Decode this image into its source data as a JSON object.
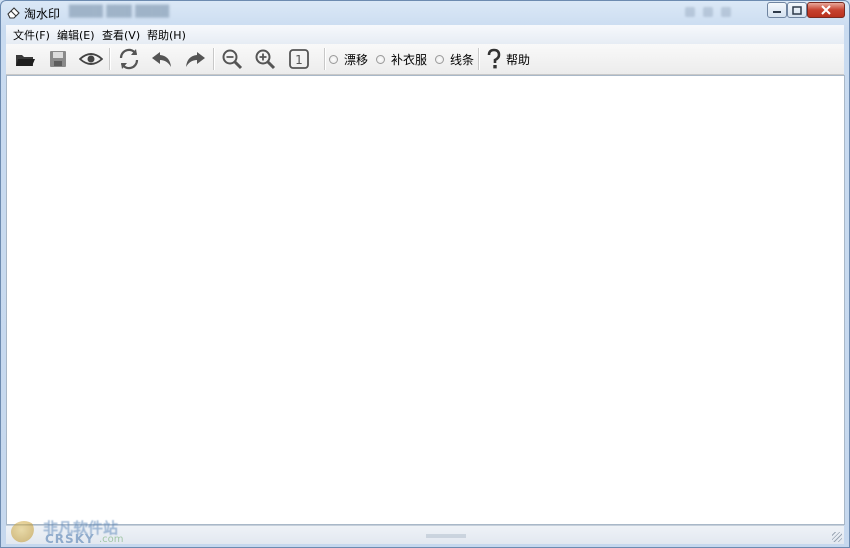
{
  "window": {
    "title": "淘水印"
  },
  "menu": [
    {
      "label": "文件(F)"
    },
    {
      "label": "编辑(E)"
    },
    {
      "label": "查看(V)"
    },
    {
      "label": "帮助(H)"
    }
  ],
  "toolbar": {
    "buttons": [
      {
        "icon": "open-folder-icon"
      },
      {
        "icon": "save-icon"
      },
      {
        "icon": "eye-icon"
      },
      {
        "icon": "refresh-icon"
      },
      {
        "icon": "undo-icon"
      },
      {
        "icon": "redo-icon"
      },
      {
        "icon": "zoom-out-icon"
      },
      {
        "icon": "zoom-in-icon"
      },
      {
        "icon": "actual-size-icon",
        "text": "1"
      }
    ],
    "modes": [
      {
        "label": "漂移",
        "selected": false
      },
      {
        "label": "补衣服",
        "selected": false
      },
      {
        "label": "线条",
        "selected": false
      }
    ],
    "help": {
      "icon": "question-icon",
      "label": "帮助"
    }
  },
  "watermark": {
    "cn": "非凡软件站",
    "en": "CRSKY",
    "domain": ".com"
  },
  "colors": {
    "canvas": "#ffffff",
    "titlebar": "#dbe8f6",
    "close": "#c7422f"
  }
}
